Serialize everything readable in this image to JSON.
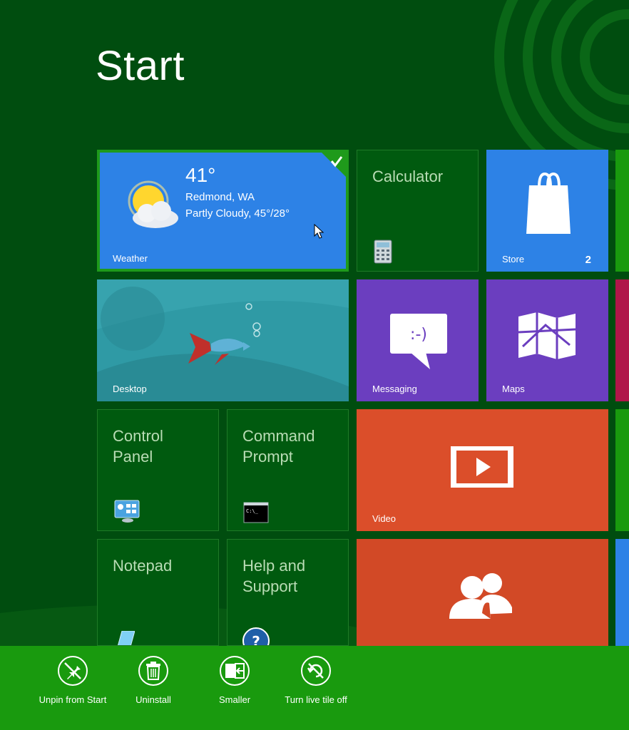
{
  "page": {
    "title": "Start"
  },
  "tiles": {
    "weather": {
      "name": "Weather",
      "temperature": "41°",
      "location": "Redmond, WA",
      "conditions": "Partly Cloudy, 45°/28°",
      "selected": true
    },
    "calculator": {
      "name": "Calculator"
    },
    "store": {
      "name": "Store",
      "badge": "2"
    },
    "desktop": {
      "name": "Desktop"
    },
    "messaging": {
      "name": "Messaging"
    },
    "maps": {
      "name": "Maps"
    },
    "control_panel": {
      "name": "Control Panel"
    },
    "command_prompt": {
      "name": "Command Prompt"
    },
    "video": {
      "name": "Video"
    },
    "notepad": {
      "name": "Notepad"
    },
    "help_support": {
      "name": "Help and Support"
    },
    "people": {
      "name": ""
    }
  },
  "app_bar": {
    "commands": [
      {
        "label": "Unpin from Start",
        "icon": "unpin-icon"
      },
      {
        "label": "Uninstall",
        "icon": "trash-icon"
      },
      {
        "label": "Smaller",
        "icon": "resize-smaller-icon"
      },
      {
        "label": "Turn live tile off",
        "icon": "live-tile-off-icon"
      }
    ]
  },
  "colors": {
    "background": "#004d0f",
    "app_bar": "#199a0e",
    "weather": "#2d82e6",
    "store": "#2d82e6",
    "messaging": "#6b3ebf",
    "maps": "#6b3ebf",
    "video": "#db4e2a",
    "people": "#d24926",
    "desktop": "#2a8e99"
  }
}
